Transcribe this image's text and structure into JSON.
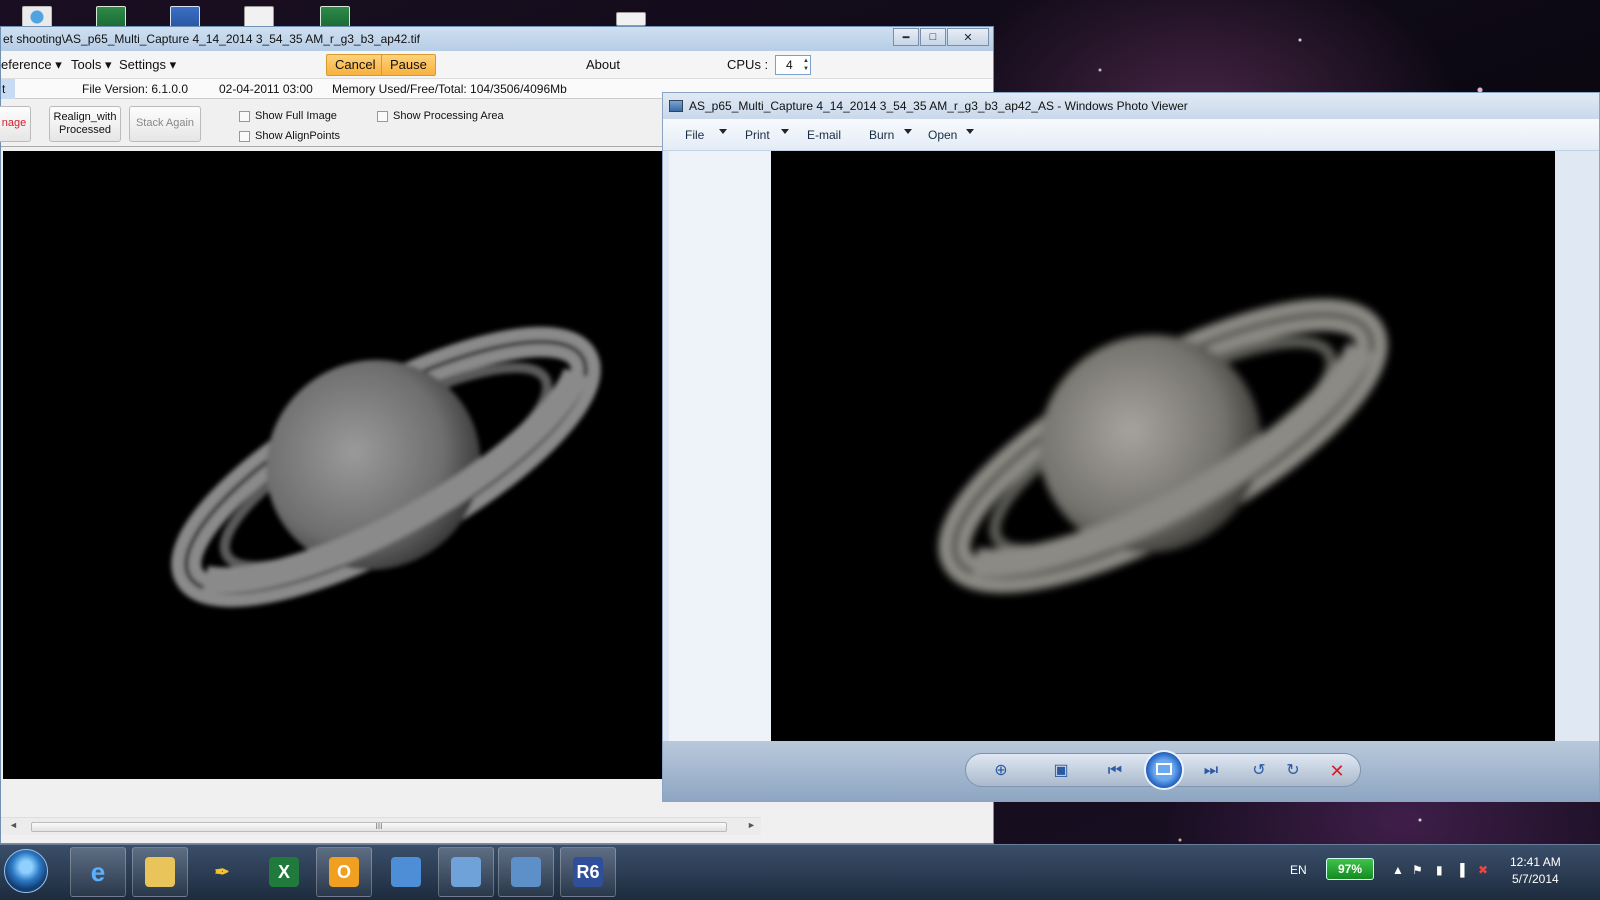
{
  "desktop": {
    "icons": [
      "globe-shortcut-icon",
      "excel-file-icon",
      "word-file-icon",
      "document-file-icon",
      "excel-file-icon"
    ]
  },
  "autostakkert": {
    "title": "et shooting\\AS_p65_Multi_Capture 4_14_2014 3_54_35 AM_r_g3_b3_ap42.tif",
    "menu": [
      "eference",
      "Tools",
      "Settings",
      "About"
    ],
    "cancel_label": "Cancel",
    "pause_label": "Pause",
    "cpus_label": "CPUs :",
    "cpus_value": "4",
    "tab_stub": "t",
    "file_version": "File Version: 6.1.0.0",
    "file_date": "02-04-2011 03:00",
    "memory": "Memory Used/Free/Total: 104/3506/4096Mb",
    "toolbar": {
      "image_stub": "nage",
      "realign_line1": "Realign_with",
      "realign_line2": "Processed",
      "stack_again": "Stack Again",
      "show_full_image": "Show Full Image",
      "show_alignpoints": "Show AlignPoints",
      "show_processing_area": "Show Processing Area"
    },
    "scroll_grip": "III"
  },
  "photo_viewer": {
    "title": "AS_p65_Multi_Capture 4_14_2014 3_54_35 AM_r_g3_b3_ap42_AS - Windows Photo Viewer",
    "menu": [
      "File",
      "Print",
      "E-mail",
      "Burn",
      "Open"
    ]
  },
  "taskbar": {
    "apps": [
      "internet-explorer-icon",
      "file-explorer-icon",
      "pen-tool-icon",
      "excel-app-icon",
      "outlook-app-icon",
      "remote-desktop-icon",
      "network-app-icon",
      "photo-viewer-icon",
      "registax-icon"
    ],
    "registax_label": "R6",
    "language": "EN",
    "battery": "97%",
    "time": "12:41 AM",
    "date": "5/7/2014"
  },
  "colors": {
    "orange_button": "#f7b13f",
    "title_blue": "#b6cde6",
    "taskbar": "#1d2b3e"
  }
}
